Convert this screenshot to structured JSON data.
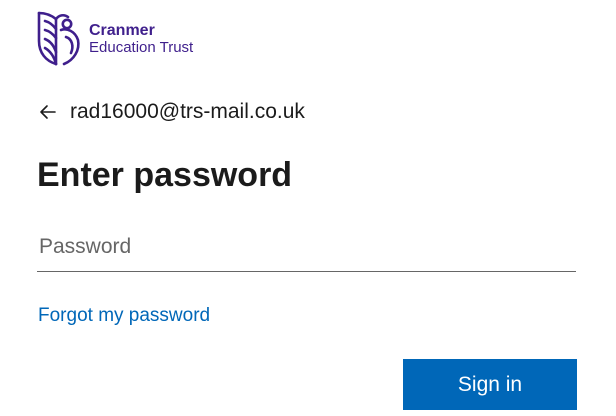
{
  "brand": {
    "name": "Cranmer",
    "subtitle": "Education Trust",
    "color": "#3f1f8c",
    "icon": "owl-crest-logo"
  },
  "identity": {
    "back_icon": "left-arrow-icon",
    "email": "rad16000@trs-mail.co.uk"
  },
  "title": "Enter password",
  "password": {
    "placeholder": "Password",
    "value": ""
  },
  "forgot_link": "Forgot my password",
  "signin_button": "Sign in",
  "colors": {
    "accent": "#0067b8",
    "text": "#1b1b1b",
    "field_border": "#666666"
  }
}
